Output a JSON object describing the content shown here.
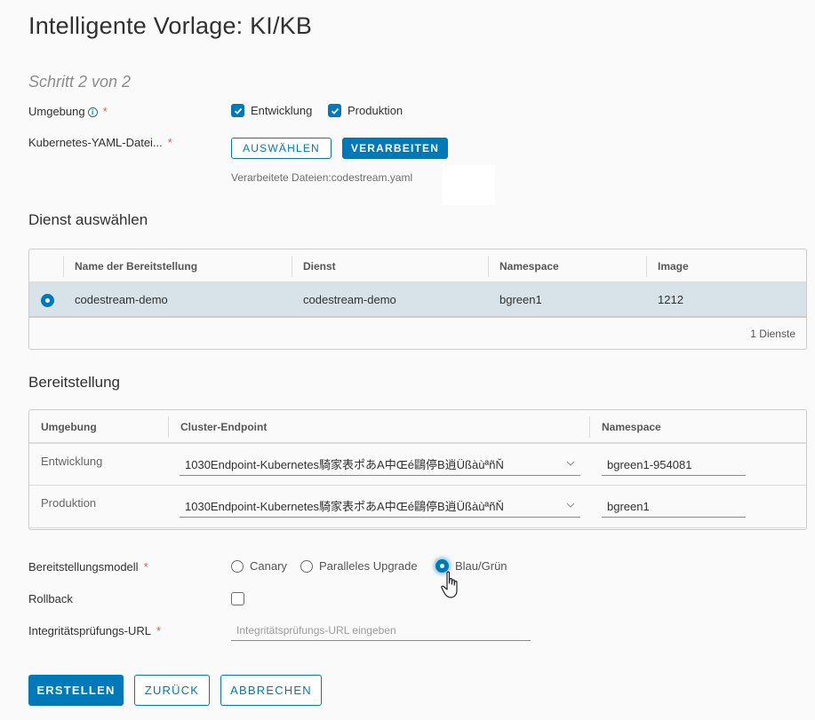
{
  "page": {
    "title": "Intelligente Vorlage: KI/KB",
    "step": "Schritt 2 von 2"
  },
  "environment": {
    "label": "Umgebung",
    "info_icon": "info-icon",
    "required": "*",
    "options": [
      {
        "label": "Entwicklung",
        "checked": true
      },
      {
        "label": "Produktion",
        "checked": true
      }
    ]
  },
  "yaml": {
    "label": "Kubernetes-YAML-Datei...",
    "required": "*",
    "select_button": "AUSWÄHLEN",
    "process_button": "VERARBEITEN",
    "processed_files": "Verarbeitete Dateien:codestream.yaml"
  },
  "service": {
    "section_title": "Dienst auswählen",
    "columns": [
      "Name der Bereitstellung",
      "Dienst",
      "Namespace",
      "Image"
    ],
    "rows": [
      {
        "selected": true,
        "deployment": "codestream-demo",
        "service": "codestream-demo",
        "namespace": "bgreen1",
        "image": "1212"
      }
    ],
    "footer": "1 Dienste"
  },
  "deployment": {
    "section_title": "Bereitstellung",
    "columns": [
      "Umgebung",
      "Cluster-Endpoint",
      "Namespace"
    ],
    "rows": [
      {
        "environment": "Entwicklung",
        "endpoint": "1030Endpoint-Kubernetes騎家表ポあA中Œé鷗停B逍ÜßàùªñŇ",
        "namespace": "bgreen1-954081"
      },
      {
        "environment": "Produktion",
        "endpoint": "1030Endpoint-Kubernetes騎家表ポあA中Œé鷗停B逍ÜßàùªñŇ",
        "namespace": "bgreen1"
      }
    ]
  },
  "model": {
    "label": "Bereitstellungsmodell",
    "required": "*",
    "options": [
      {
        "label": "Canary",
        "selected": false
      },
      {
        "label": "Paralleles Upgrade",
        "selected": false
      },
      {
        "label": "Blau/Grün",
        "selected": true
      }
    ]
  },
  "rollback": {
    "label": "Rollback",
    "checked": false
  },
  "health_url": {
    "label": "Integritätsprüfungs-URL",
    "required": "*",
    "value": "",
    "placeholder": "Integritätsprüfungs-URL eingeben"
  },
  "actions": {
    "create": "ERSTELLEN",
    "back": "ZURÜCK",
    "cancel": "ABBRECHEN"
  },
  "colors": {
    "accent": "#0079b8",
    "selected_row": "#d8e3e9",
    "required": "#e05a4e"
  }
}
